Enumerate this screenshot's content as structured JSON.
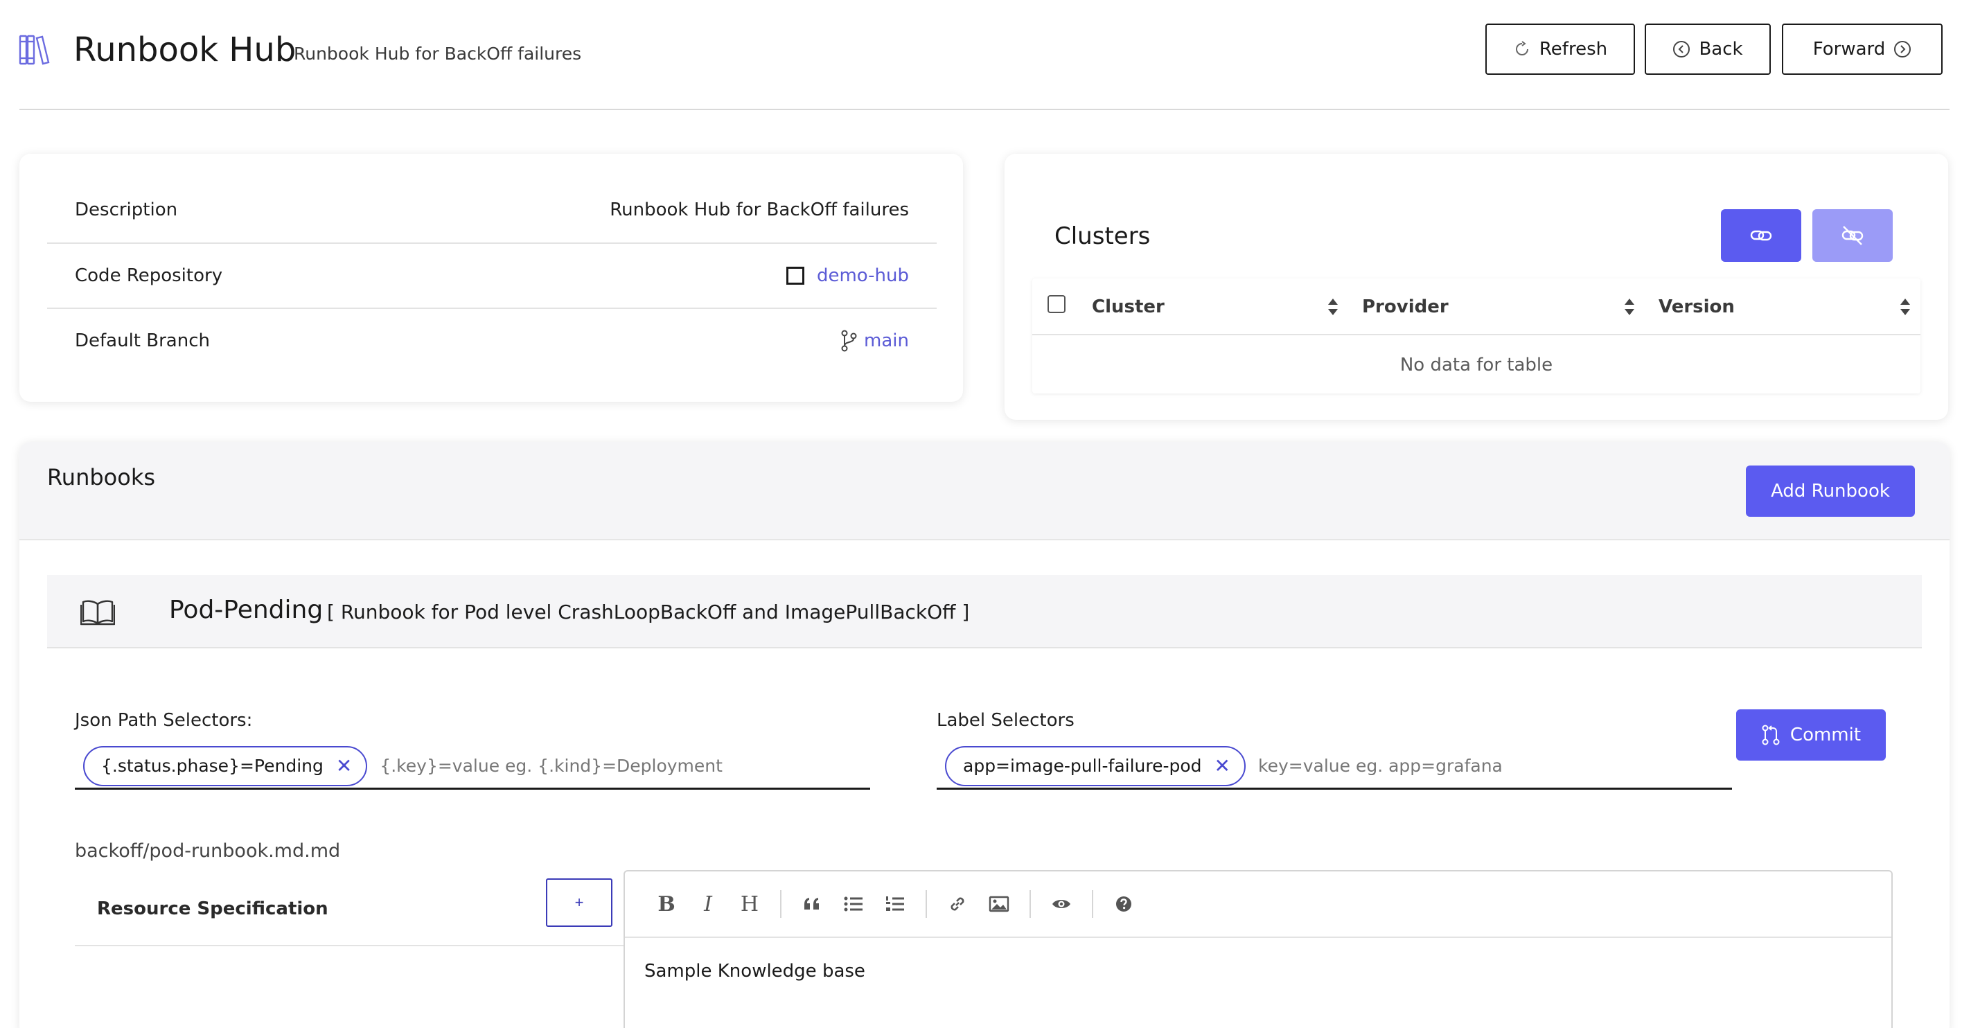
{
  "header": {
    "title": "Runbook Hub",
    "subtitle": "Runbook Hub for BackOff failures",
    "icon": "library-books-icon",
    "buttons": {
      "refresh": "Refresh",
      "back": "Back",
      "forward": "Forward"
    }
  },
  "info": {
    "rows": [
      {
        "label": "Description",
        "value": "Runbook Hub for BackOff failures"
      },
      {
        "label": "Code Repository",
        "value": "demo-hub"
      },
      {
        "label": "Default Branch",
        "value": "main"
      }
    ]
  },
  "clusters": {
    "title": "Clusters",
    "columns": [
      "Cluster",
      "Provider",
      "Version"
    ],
    "empty_text": "No data for table"
  },
  "runbooks": {
    "title": "Runbooks",
    "add_label": "Add Runbook",
    "item": {
      "name": "Pod-Pending",
      "description": "[ Runbook for Pod level CrashLoopBackOff and ImagePullBackOff ]",
      "json_label": "Json Path Selectors:",
      "json_chip": "{.status.phase}=Pending",
      "json_placeholder": "{.key}=value eg. {.kind}=Deployment",
      "label_label": "Label Selectors",
      "label_chip": "app=image-pull-failure-pod",
      "label_placeholder": "key=value eg. app=grafana",
      "commit_label": "Commit",
      "file_path": "backoff/pod-runbook.md.md",
      "spec_label": "Resource Specification",
      "spec_add": "+",
      "editor_text": "Sample Knowledge base",
      "toolbar": {
        "bold": "B",
        "italic": "I",
        "heading": "H"
      }
    }
  },
  "colors": {
    "accent": "#5b5bf0",
    "accent_light": "#9b9bf7",
    "link": "#5b5bd6",
    "panel_bg": "#f5f5f7"
  }
}
